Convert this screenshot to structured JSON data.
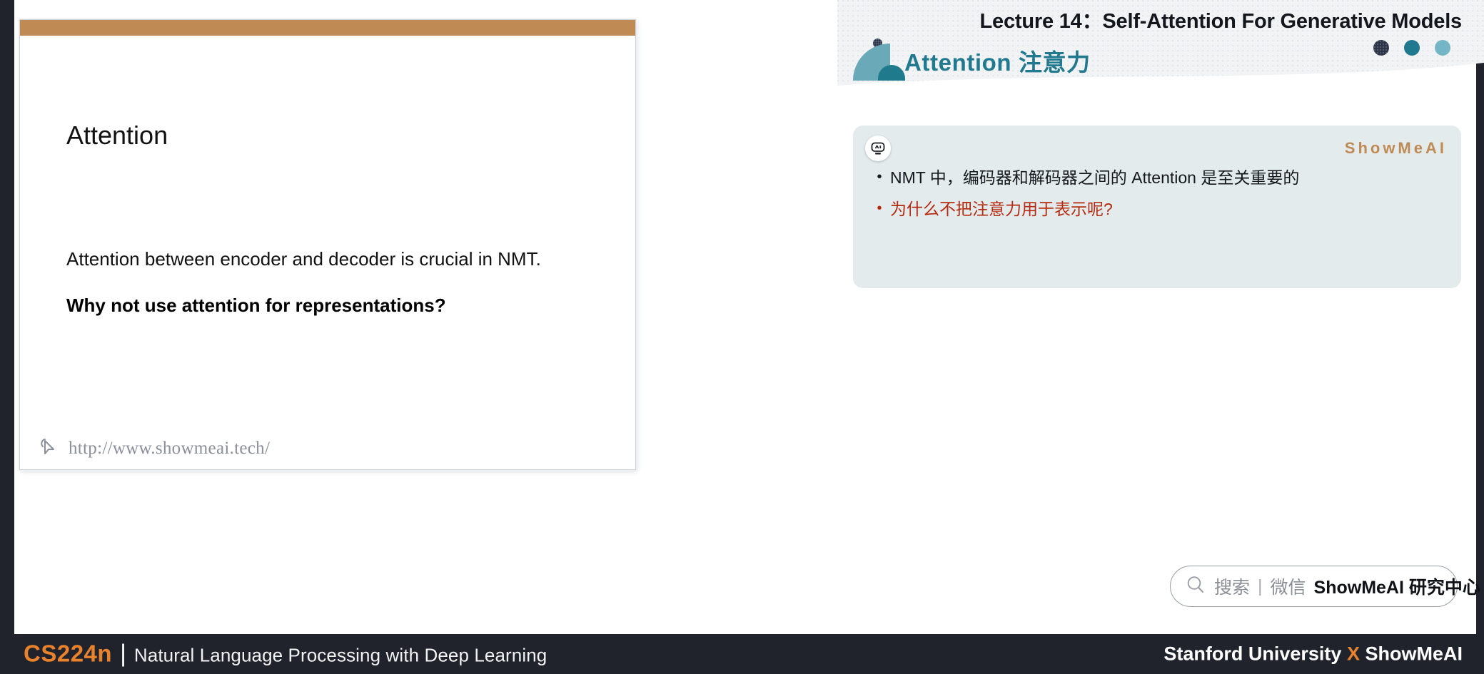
{
  "footer": {
    "course_code": "CS224n",
    "separator": "|",
    "course_name": "Natural Language Processing with Deep Learning",
    "credit_left": "Stanford University",
    "credit_x": "X",
    "credit_right": "ShowMeAI"
  },
  "slide": {
    "topbar_color": "#c08a55",
    "title": "Attention",
    "line1": "Attention between encoder and decoder is crucial in NMT.",
    "line2": "Why not use attention for representations?",
    "watermark_icon": "cursor-arrow-icon",
    "watermark_url": "http://www.showmeai.tech/"
  },
  "right_panel": {
    "lecture_title": "Lecture 14：Self-Attention For Generative Models",
    "section_heading": "Attention 注意力",
    "dots": [
      {
        "name": "dot-navy",
        "color": "#2c3445"
      },
      {
        "name": "dot-teal",
        "color": "#21798f"
      },
      {
        "name": "dot-light-teal",
        "color": "#74b5c6"
      }
    ],
    "note_box": {
      "background": "#e3ebec",
      "ai_icon": "ai-robot-face-icon",
      "brand": "ShowMeAI",
      "brand_color": "#c08a55",
      "bullets": [
        {
          "marker": "•",
          "text": "NMT 中，编码器和解码器之间的 Attention 是至关重要的",
          "accent": false
        },
        {
          "marker": "•",
          "text": "为什么不把注意力用于表示呢?",
          "accent": true,
          "color": "#b52b10"
        }
      ]
    },
    "search": {
      "icon": "search-magnifier-icon",
      "placeholder": "搜索",
      "divider": "|",
      "channel": "微信",
      "value": "ShowMeAI 研究中心"
    }
  }
}
